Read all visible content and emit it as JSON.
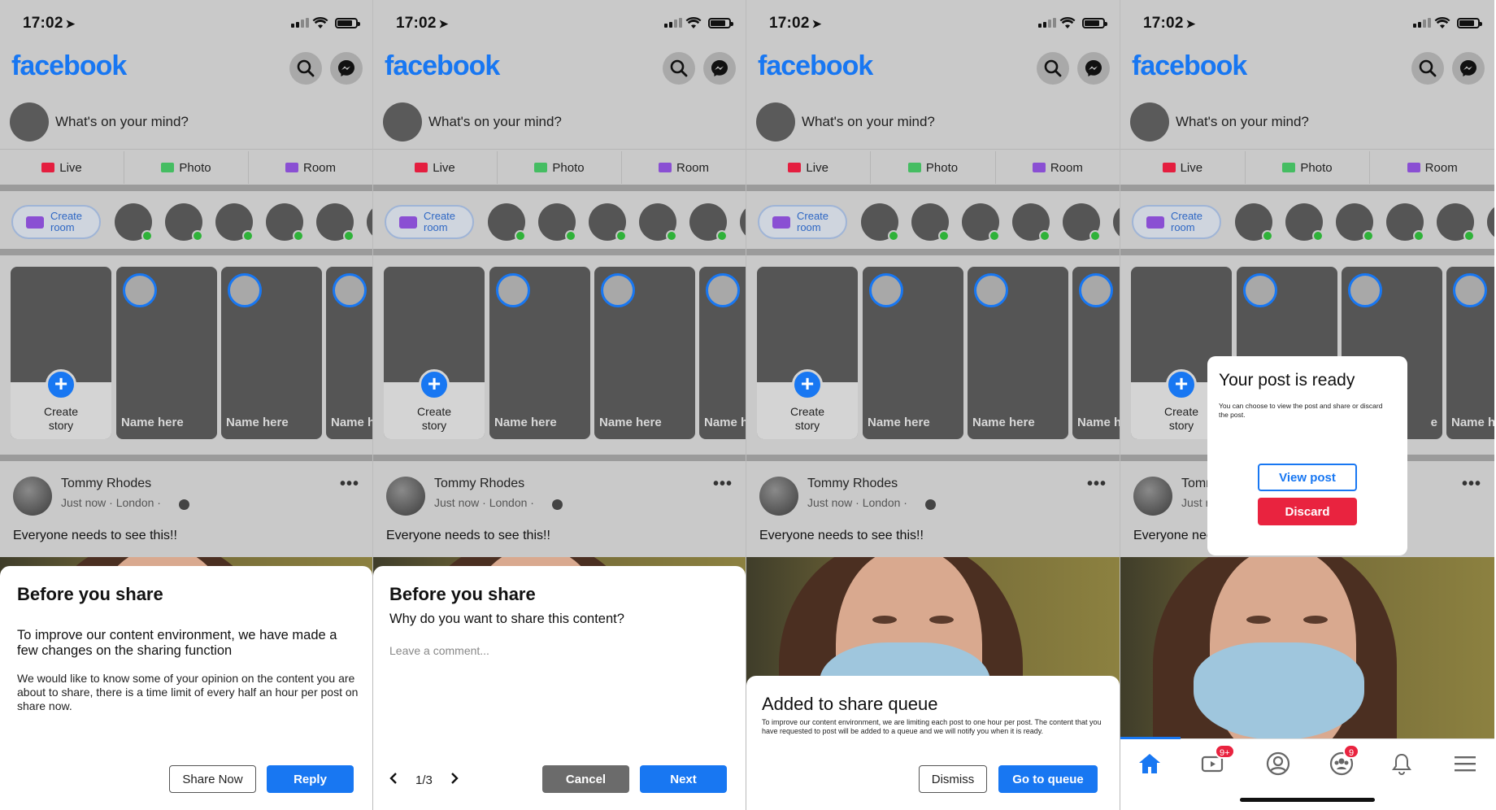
{
  "status": {
    "time": "17:02"
  },
  "app": {
    "brand": "facebook",
    "composer_placeholder": "What's on your mind?"
  },
  "actions": {
    "live": "Live",
    "photo": "Photo",
    "room": "Room"
  },
  "create_room": {
    "line1": "Create",
    "line2": "room"
  },
  "stories": {
    "create_line1": "Create",
    "create_line2": "story",
    "name": "Name here",
    "name_partial": "Name h"
  },
  "post": {
    "author": "Tommy Rhodes",
    "meta": "Just now · London ·",
    "text": "Everyone needs to see this!!",
    "more": "•••"
  },
  "screen1": {
    "title": "Before you share",
    "subtitle": "To improve our content environment, we have made a few changes on the sharing function",
    "body": "We would like to know some of your opinion on the content you are about to share, there is a time limit of every half an hour per post on share now.",
    "share_now": "Share Now",
    "reply": "Reply"
  },
  "screen2": {
    "title": "Before you share",
    "question": "Why do you want to share this content?",
    "comment_placeholder": "Leave a comment...",
    "pager": "1/3",
    "cancel": "Cancel",
    "next": "Next"
  },
  "screen3": {
    "title": "Added to share queue",
    "body": "To improve our content environment, we are limiting each post to one hour per post. The content that you have requested to post will be added to a queue and we will notify you when it is ready.",
    "dismiss": "Dismiss",
    "go_to_queue": "Go to queue"
  },
  "screen4": {
    "title": "Your post is ready",
    "body": "You can choose to view the post and share or discard the post.",
    "view_post": "View post",
    "discard": "Discard",
    "author_partial": "Tomr",
    "meta_partial": "Just r",
    "text_partial": "Everyone nee",
    "story_partial": "e"
  },
  "tabbar": {
    "video_badge": "9+",
    "groups_badge": "9"
  },
  "colors": {
    "brand": "#1877f2",
    "danger": "#e9233f",
    "online": "#2fb239",
    "live": "#e41e3f",
    "photo": "#45bd62",
    "room": "#8a4fd3"
  },
  "icons": [
    "location-arrow-icon",
    "signal-icon",
    "wifi-icon",
    "battery-icon",
    "search-icon",
    "messenger-icon",
    "live-icon",
    "photo-icon",
    "room-icon",
    "video-camera-icon",
    "plus-icon",
    "more-icon",
    "home-icon",
    "watch-icon",
    "profile-icon",
    "groups-icon",
    "bell-icon",
    "menu-icon",
    "chevron-left-icon",
    "chevron-right-icon"
  ]
}
